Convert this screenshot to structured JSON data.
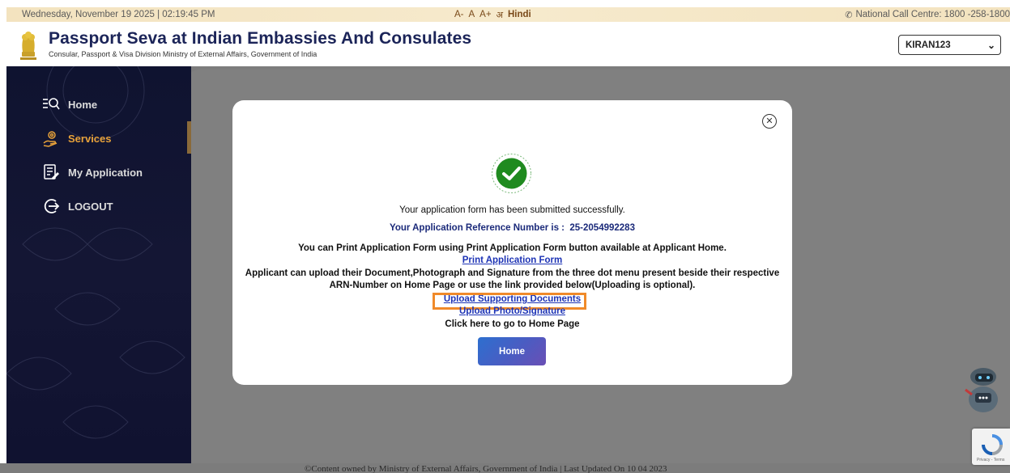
{
  "topbar": {
    "datetime": "Wednesday, November 19 2025 | 02:19:45 PM",
    "font_small": "A-",
    "font_normal": "A",
    "font_large": "A+",
    "language_icon": "translate-icon",
    "language": "Hindi",
    "call_centre": "National Call Centre: 1800 -258-1800"
  },
  "header": {
    "title": "Passport Seva at Indian Embassies And Consulates",
    "subtitle": "Consular, Passport & Visa Division Ministry of External Affairs, Government of India",
    "user": "KIRAN123"
  },
  "sidebar": {
    "items": [
      {
        "label": "Home",
        "icon": "search-list-icon"
      },
      {
        "label": "Services",
        "icon": "hand-gear-icon"
      },
      {
        "label": "My Application",
        "icon": "document-edit-icon"
      },
      {
        "label": "LOGOUT",
        "icon": "logout-icon"
      }
    ],
    "active": "Services"
  },
  "modal": {
    "line1": "Your application form has been submitted successfully.",
    "ref_label": "Your Application Reference Number is :",
    "ref_number": "25-2054992283",
    "line3": "You can Print Application Form using Print Application Form button available at Applicant Home.",
    "print_link": "Print Application Form",
    "line5": "Applicant can upload their Document,Photograph and Signature from the three dot menu present beside their respective",
    "line6": "ARN-Number on Home Page or use the link provided below(Uploading is optional).",
    "upload_docs_link": "Upload Supporting Documents",
    "upload_photo_link": "Upload Photo/Signature",
    "home_text": "Click here to go to Home Page",
    "home_button": "Home",
    "success_color": "#1f8a1f",
    "highlight_color": "#f08a2a"
  },
  "footer": {
    "text": "©Content owned by Ministry of External Affairs, Government of India | Last Updated On 10 04 2023"
  },
  "recaptcha": {
    "text": "Privacy - Terms"
  }
}
